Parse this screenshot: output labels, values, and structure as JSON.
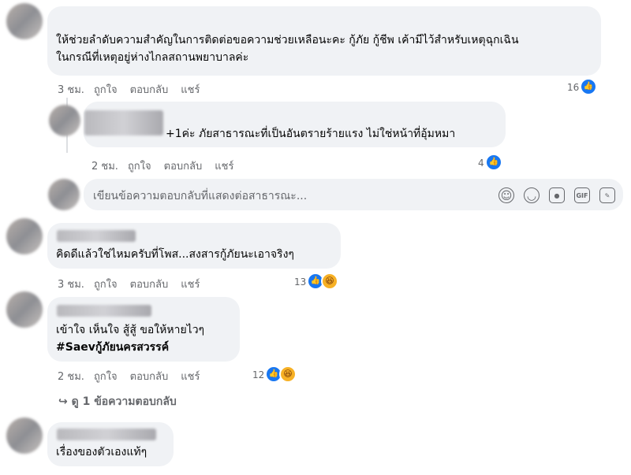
{
  "comments": [
    {
      "text_lines": [
        "ให้ช่วยลำดับความสำคัญในการติดต่อขอความช่วยเหลือนะคะ กู้ภัย กู้ชีพ เค้ามีไว้สำหรับเหตุฉุกเฉิน",
        "ในกรณีที่เหตุอยู่ห่างไกลสถานพยาบาลค่ะ"
      ],
      "time": "3 ชม.",
      "like": "ถูกใจ",
      "reply": "ตอบกลับ",
      "share": "แชร์",
      "reaction_count": "16"
    },
    {
      "text_lines": [
        "+1ค่ะ ภัยสาธารณะที่เป็นอันตรายร้ายแรง ไม่ใช่หน้าที่อุ้มหมา"
      ],
      "time": "2 ชม.",
      "like": "ถูกใจ",
      "reply": "ตอบกลับ",
      "share": "แชร์",
      "reaction_count": "4"
    },
    {
      "text_lines": [
        "คิดดีแล้วใช่ไหมครับที่โพส...สงสารกู้ภัยนะเอาจริงๆ"
      ],
      "time": "3 ชม.",
      "like": "ถูกใจ",
      "reply": "ตอบกลับ",
      "share": "แชร์",
      "reaction_count": "13"
    },
    {
      "text_lines": [
        "เข้าใจ เห็นใจ สู้สู้ ขอให้หายไวๆ",
        "#Saevกู้ภัยนครสวรรค์"
      ],
      "time": "2 ชม.",
      "like": "ถูกใจ",
      "reply": "ตอบกลับ",
      "share": "แชร์",
      "reaction_count": "12"
    },
    {
      "text_lines": [
        "เรื่องของตัวเองแท้ๆ"
      ]
    }
  ],
  "reply_input": {
    "placeholder": "เขียนข้อความตอบกลับที่แสดงต่อสาธารณะ...",
    "tools": [
      "avatar-sticker-icon",
      "emoji-icon",
      "camera-icon",
      "gif-icon",
      "sticker-icon"
    ],
    "gif_label": "GIF"
  },
  "view_replies": {
    "arrow": "↪",
    "label": "ดู 1 ข้อความตอบกลับ"
  },
  "colors": {
    "bubble": "#f0f2f5",
    "meta_text": "#65676b",
    "like_blue": "#1877f2",
    "haha_yellow": "#f7b125"
  }
}
